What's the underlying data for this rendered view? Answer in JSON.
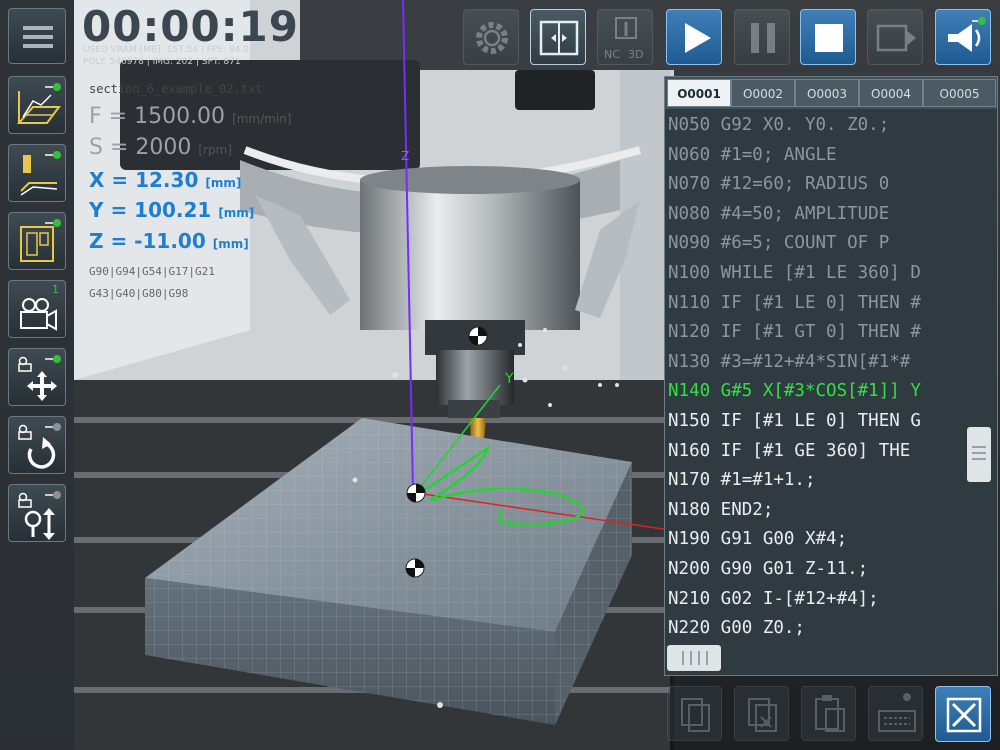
{
  "timer": {
    "elapsed": "00:00:19"
  },
  "stats": {
    "line1": "USED VRAM [MB]: 157.54 | FPS: 94.0",
    "line2": "POLY: 546978 | IMG: 202 | SPT: 871"
  },
  "readout": {
    "filename": "section_6_example_02.txt",
    "feed": {
      "label": "F = 1500.00",
      "unit": "[mm/min]"
    },
    "speed": {
      "label": "S = 2000",
      "unit": "[rpm]"
    },
    "x": {
      "label": "X = 12.30",
      "unit": "[mm]"
    },
    "y": {
      "label": "Y = 100.21",
      "unit": "[mm]"
    },
    "z": {
      "label": "Z = -11.00",
      "unit": "[mm]"
    },
    "modal_line1": "G90|G94|G54|G17|G21",
    "modal_line2": "G43|G40|G80|G98"
  },
  "camera_badge": "1",
  "axes_labels": {
    "z": "Z",
    "y": "Y"
  },
  "editor": {
    "tabs": [
      "O0001",
      "O0002",
      "O0003",
      "O0004",
      "O0005"
    ],
    "active_tab": "O0001",
    "lines": [
      "N050 G92 X0. Y0. Z0.;",
      "N060 #1=0;   ANGLE",
      "N070 #12=60; RADIUS 0",
      "N080 #4=50;  AMPLITUDE",
      "N090 #6=5;   COUNT OF P",
      "N100 WHILE [#1 LE 360] D",
      "N110 IF [#1 LE 0] THEN #",
      "N120 IF [#1 GT 0] THEN #",
      "N130 #3=#12+#4*SIN[#1*#",
      "N140 G#5 X[#3*COS[#1]] Y",
      "N150 IF [#1 LE 0] THEN G",
      "N160 IF [#1 GE 360] THE",
      "N170 #1=#1+1.;",
      "N180 END2;",
      "N190 G91 G00 X#4;",
      "N200 G90 G01 Z-11.;",
      "N210 G02 I-[#12+#4];",
      "N220 G00 Z0.;"
    ],
    "current_line_index": 9,
    "dim_line_count": 9
  },
  "colors": {
    "accent_blue": "#1e7fcf",
    "current_line": "#33e043",
    "toolpath": "#22d52f",
    "z_axis": "#7a2cff",
    "x_axis": "#e02020"
  },
  "icons": {
    "menu": "hamburger-icon",
    "settings": "gear-icon",
    "play": "play-icon",
    "pause": "pause-icon",
    "stop": "stop-icon",
    "close": "close-icon"
  }
}
